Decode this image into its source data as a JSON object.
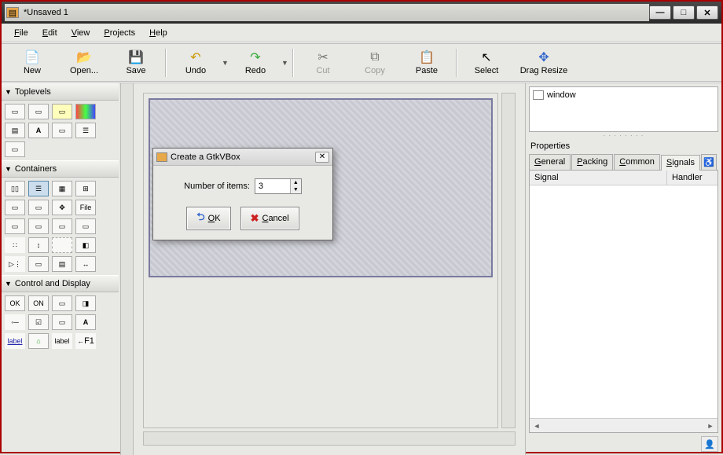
{
  "window": {
    "title": "*Unsaved 1"
  },
  "menu": {
    "file": "File",
    "edit": "Edit",
    "view": "View",
    "projects": "Projects",
    "help": "Help"
  },
  "toolbar": {
    "new": "New",
    "open": "Open...",
    "save": "Save",
    "undo": "Undo",
    "redo": "Redo",
    "cut": "Cut",
    "copy": "Copy",
    "paste": "Paste",
    "select": "Select",
    "drag": "Drag Resize"
  },
  "palette": {
    "toplevels": "Toplevels",
    "containers": "Containers",
    "control": "Control and Display",
    "file": "File",
    "ok": "OK",
    "on": "ON",
    "a": "A",
    "f1": "F1",
    "label1": "label",
    "label2": "label"
  },
  "tree": {
    "root": "window"
  },
  "props": {
    "title": "Properties",
    "tabs": {
      "general": "General",
      "packing": "Packing",
      "common": "Common",
      "signals": "Signals"
    },
    "cols": {
      "signal": "Signal",
      "handler": "Handler"
    }
  },
  "dialog": {
    "title": "Create a GtkVBox",
    "label": "Number of items:",
    "value": "3",
    "ok": "OK",
    "cancel": "Cancel"
  }
}
